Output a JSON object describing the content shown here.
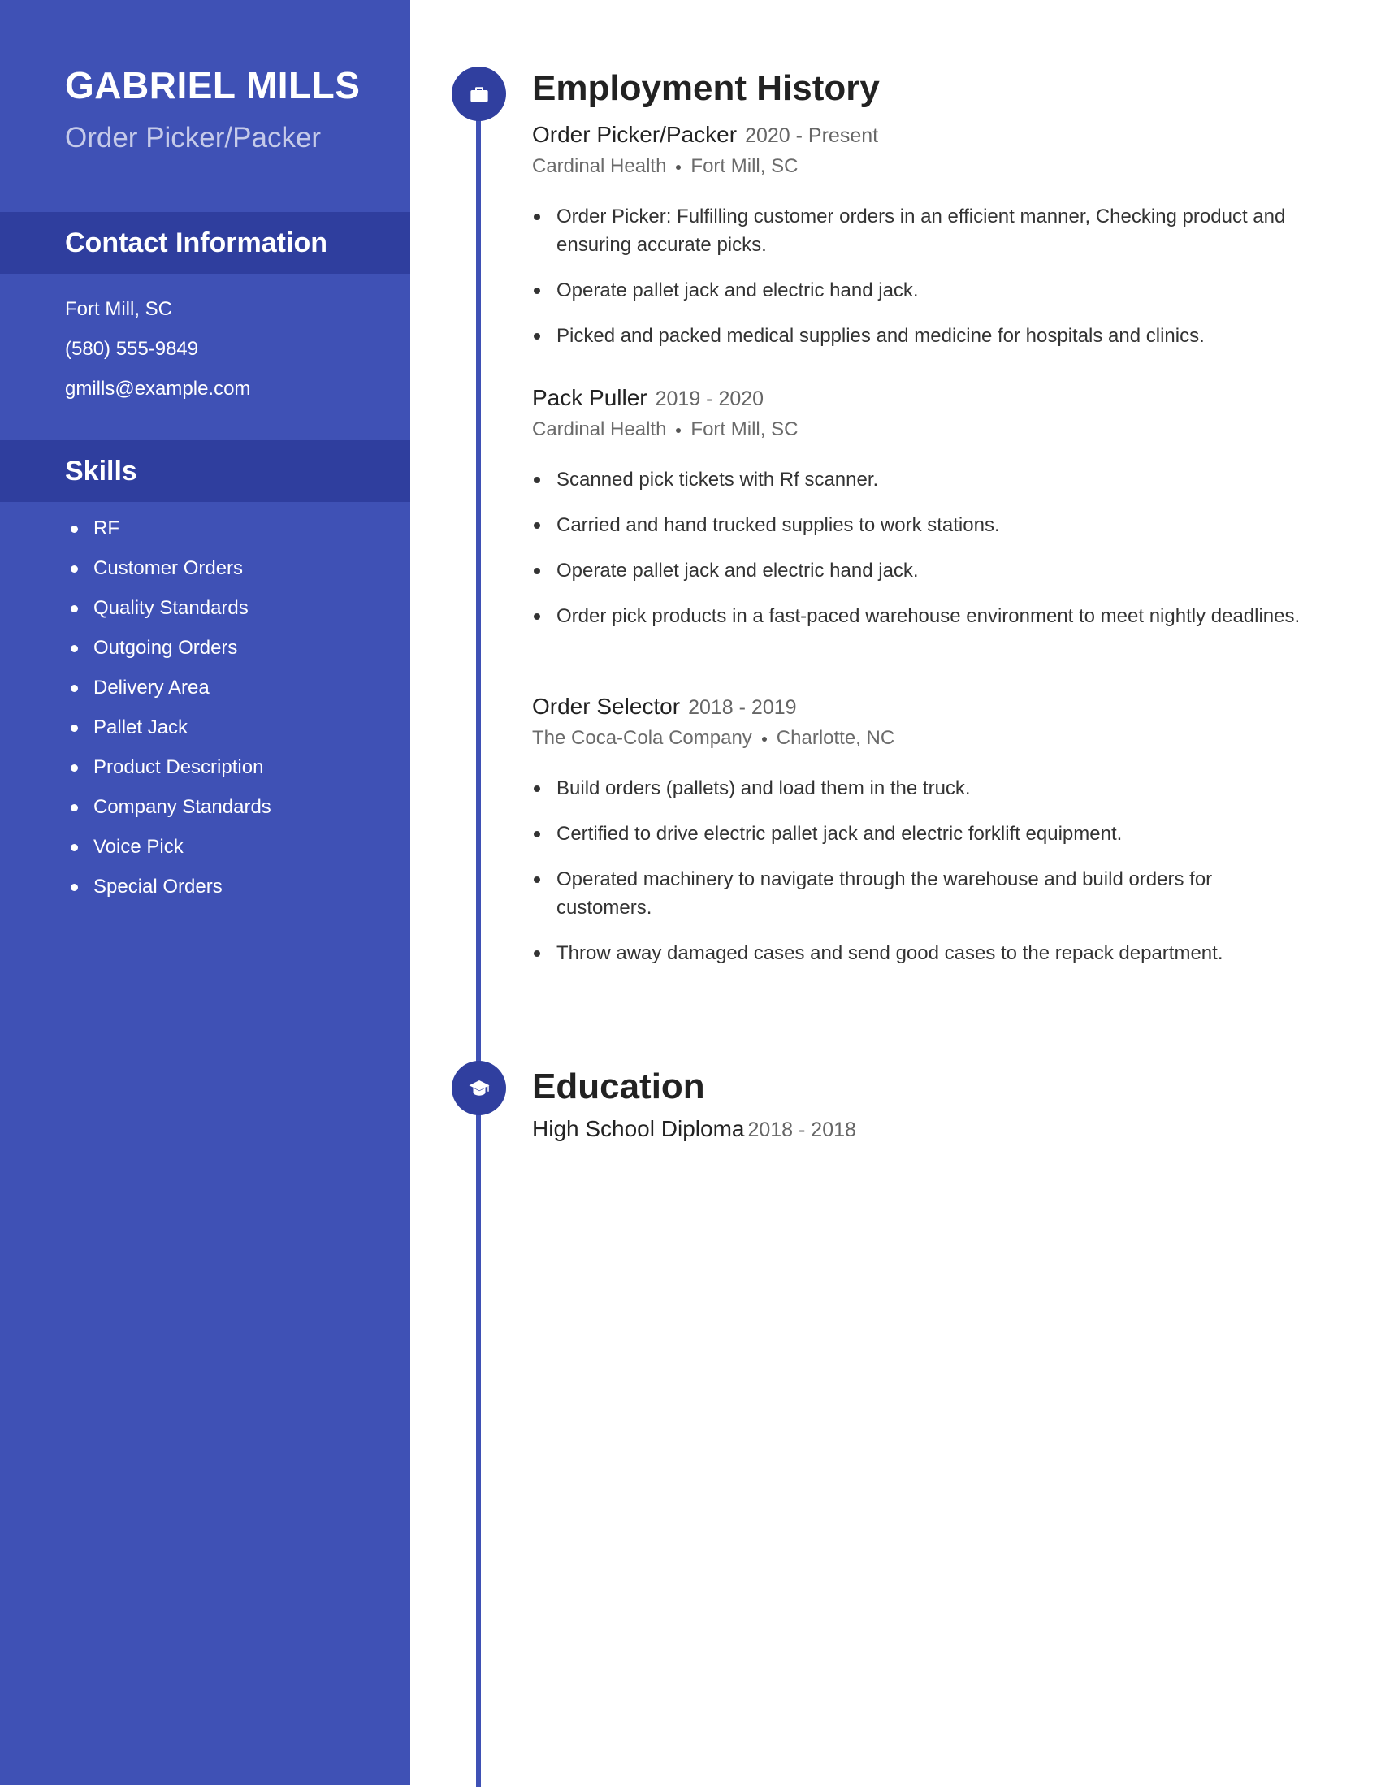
{
  "colors": {
    "sidebar": "#3F51B5",
    "sidebar_band": "#2F3E9E",
    "timeline_node": "#303F9F",
    "timeline_line": "#3F51B5",
    "role_text": "#C5CAE9"
  },
  "profile": {
    "name": "GABRIEL MILLS",
    "role": "Order Picker/Packer"
  },
  "contact": {
    "title": "Contact Information",
    "items": [
      "Fort Mill, SC",
      "(580) 555-9849",
      "gmills@example.com"
    ]
  },
  "skills": {
    "title": "Skills",
    "items": [
      "RF",
      "Customer Orders",
      "Quality Standards",
      "Outgoing Orders",
      "Delivery Area",
      "Pallet Jack",
      "Product Description",
      "Company Standards",
      "Voice Pick",
      "Special Orders"
    ]
  },
  "employment": {
    "title": "Employment History",
    "icon": "briefcase-icon",
    "jobs": [
      {
        "title": "Order Picker/Packer",
        "dates": "2020 - Present",
        "company": "Cardinal Health",
        "location": "Fort Mill, SC",
        "bullets": [
          "Order Picker: Fulfilling customer orders in an efficient manner, Checking product and ensuring accurate picks.",
          "Operate pallet jack and electric hand jack.",
          "Picked and packed medical supplies and medicine for hospitals and clinics."
        ]
      },
      {
        "title": "Pack Puller",
        "dates": "2019 - 2020",
        "company": "Cardinal Health",
        "location": "Fort Mill, SC",
        "bullets": [
          "Scanned pick tickets with Rf scanner.",
          "Carried and hand trucked supplies to work stations.",
          "Operate pallet jack and electric hand jack.",
          "Order pick products in a fast-paced warehouse environment to meet nightly deadlines."
        ]
      },
      {
        "title": "Order Selector",
        "dates": "2018 - 2019",
        "company": "The Coca-Cola Company",
        "location": "Charlotte, NC",
        "bullets": [
          "Build orders (pallets) and load them in the truck.",
          "Certified to drive electric pallet jack and electric forklift equipment.",
          "Operated machinery to navigate through the warehouse and build orders for customers.",
          "Throw away damaged cases and send good cases to the repack department."
        ]
      }
    ]
  },
  "education": {
    "title": "Education",
    "icon": "graduation-cap-icon",
    "items": [
      {
        "title": "High School Diploma",
        "dates": "2018 - 2018"
      }
    ]
  }
}
